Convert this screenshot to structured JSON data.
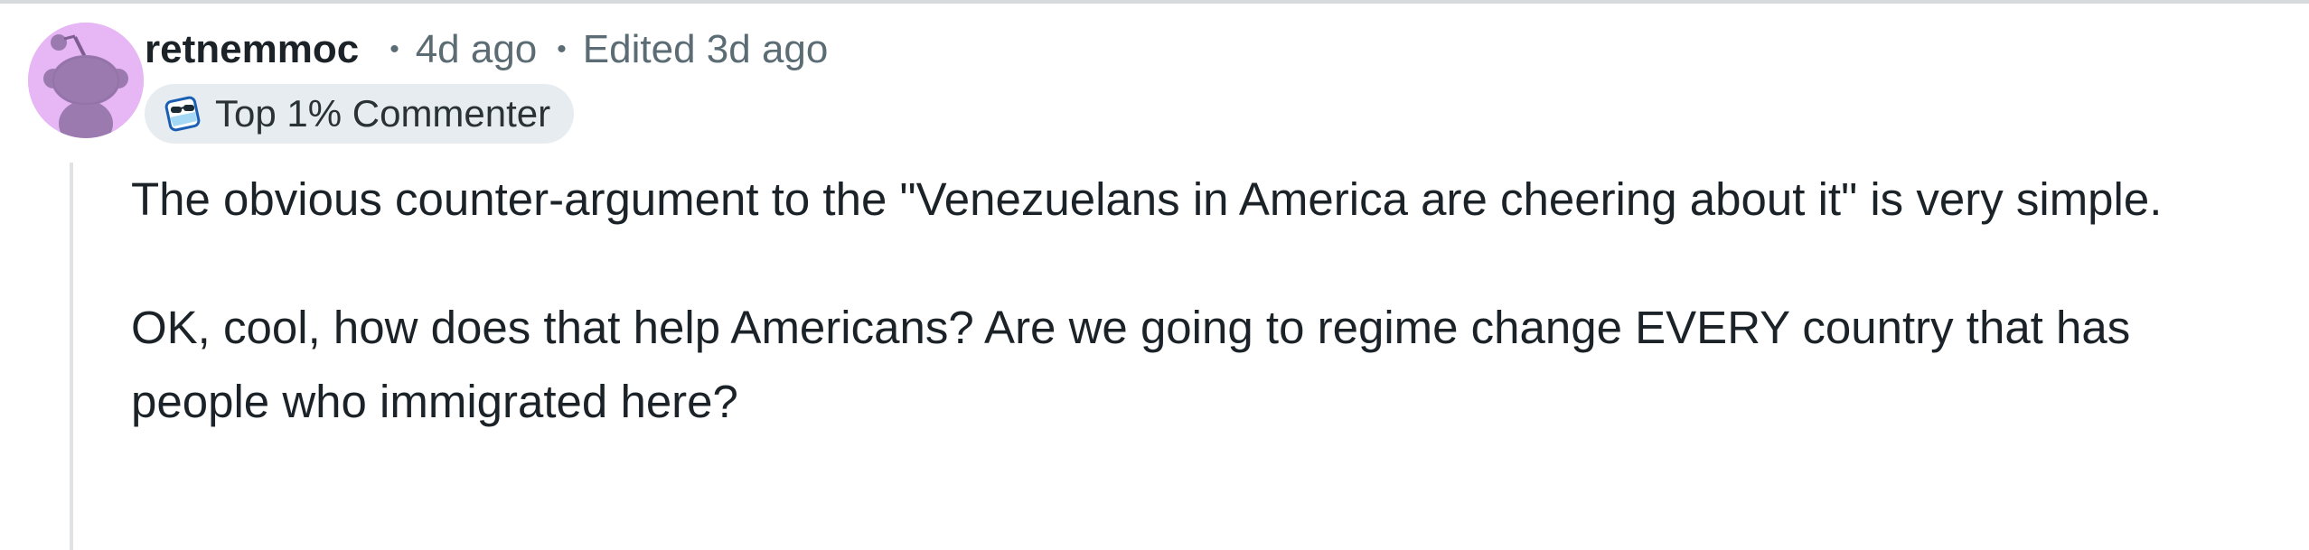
{
  "comment": {
    "author": "retnemmoc",
    "separator": "•",
    "posted": "4d ago",
    "edited": "Edited 3d ago",
    "flair": {
      "icon": "sunglasses-badge-icon",
      "label": "Top 1% Commenter"
    },
    "paragraphs": [
      "The obvious counter-argument to the \"Venezuelans in America are cheering about it\" is very simple.",
      "OK, cool, how does that help Americans? Are we going to regime change EVERY country that has people who immigrated here?"
    ]
  },
  "colors": {
    "avatar_bg": "#e7b6f5",
    "flair_bg": "#e6ecf0",
    "meta_text": "#5c6c74",
    "body_text": "#1c2328",
    "thread_line": "#dfe3e5"
  }
}
